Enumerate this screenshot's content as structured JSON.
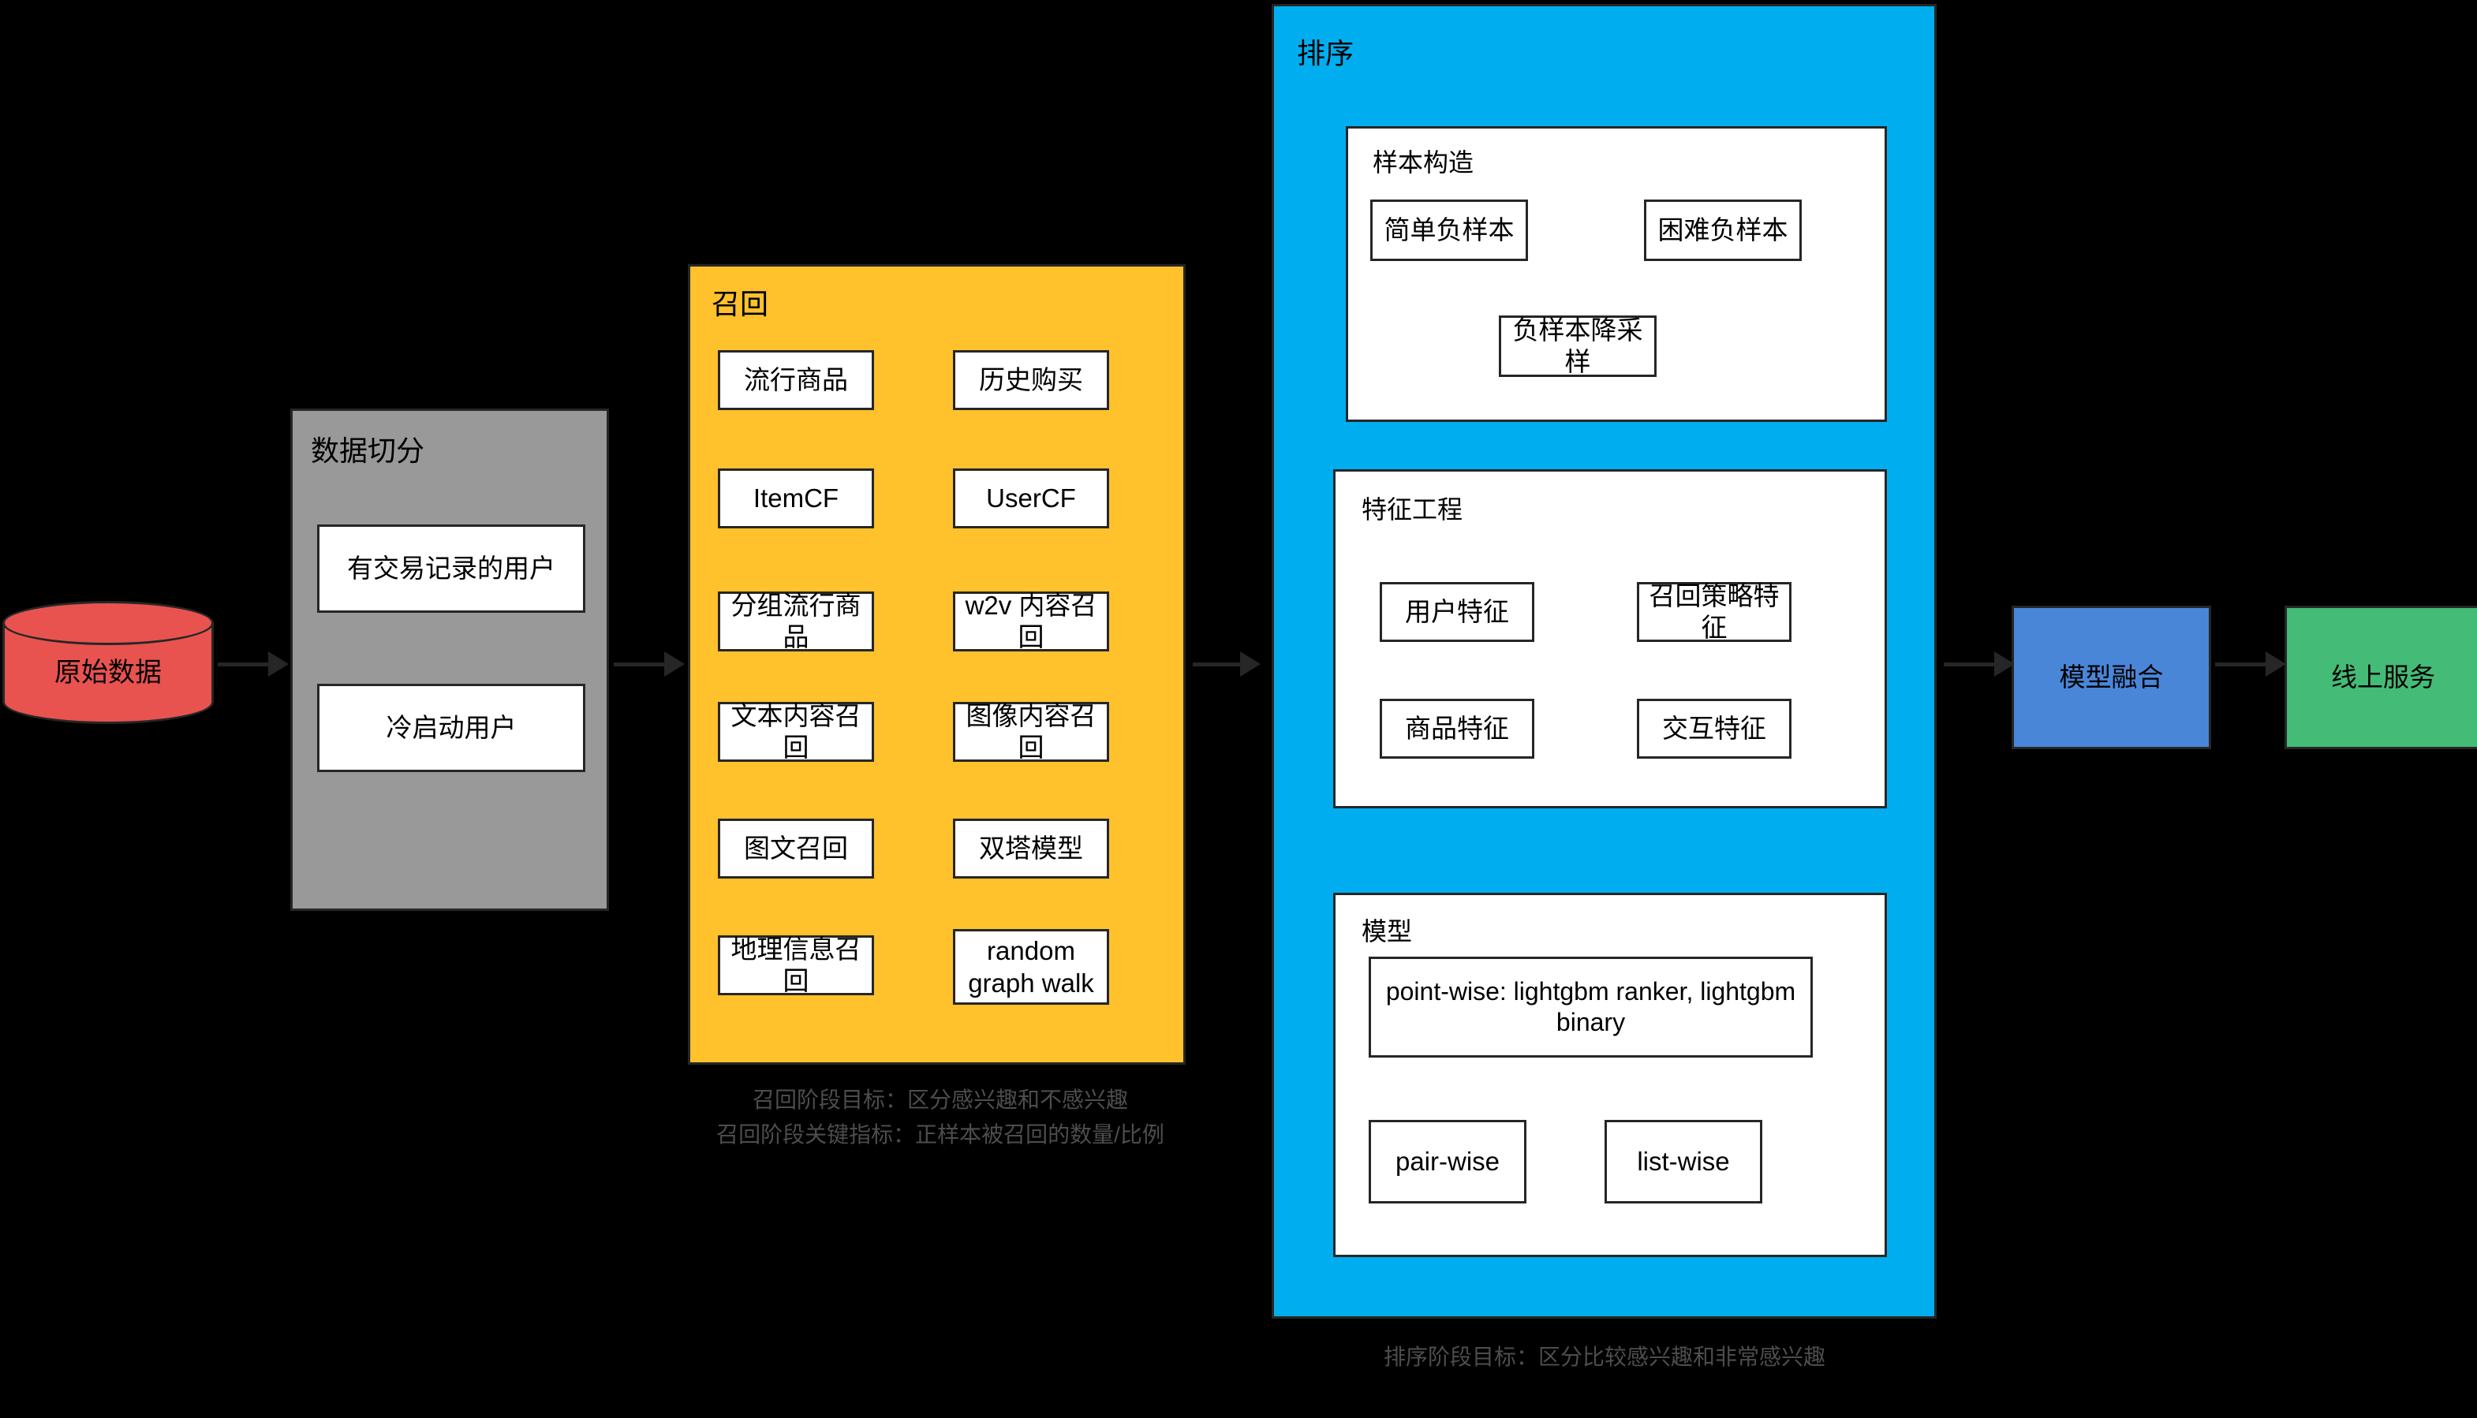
{
  "diagram": {
    "title": "recommendation-system-pipeline",
    "colors": {
      "background": "#000000",
      "raw_data_fill": "#e8534f",
      "data_split_fill": "#999999",
      "recall_fill": "#ffc12c",
      "ranking_fill": "#00aeef",
      "model_fusion_fill": "#4a86d8",
      "online_service_fill": "#44bb77",
      "panel_fill": "#ffffff",
      "stroke": "#262626",
      "caption_text": "#4d4d4d"
    }
  },
  "raw_data": {
    "label": "原始数据"
  },
  "data_split": {
    "title": "数据切分",
    "items": [
      {
        "label": "有交易记录的用户"
      },
      {
        "label": "冷启动用户"
      }
    ]
  },
  "recall": {
    "title": "召回",
    "items": [
      {
        "label": "流行商品"
      },
      {
        "label": "历史购买"
      },
      {
        "label": "ItemCF"
      },
      {
        "label": "UserCF"
      },
      {
        "label": "分组流行商品"
      },
      {
        "label": "w2v 内容召回"
      },
      {
        "label": "文本内容召回"
      },
      {
        "label": "图像内容召回"
      },
      {
        "label": "图文召回"
      },
      {
        "label": "双塔模型"
      },
      {
        "label": "地理信息召回"
      },
      {
        "label": "random graph walk"
      }
    ],
    "captions": [
      "召回阶段目标：区分感兴趣和不感兴趣",
      "召回阶段关键指标：正样本被召回的数量/比例"
    ]
  },
  "ranking": {
    "title": "排序",
    "panels": [
      {
        "title": "样本构造",
        "items": [
          {
            "label": "简单负样本"
          },
          {
            "label": "困难负样本"
          },
          {
            "label": "负样本降采样"
          }
        ]
      },
      {
        "title": "特征工程",
        "items": [
          {
            "label": "用户特征"
          },
          {
            "label": "召回策略特征"
          },
          {
            "label": "商品特征"
          },
          {
            "label": "交互特征"
          }
        ]
      },
      {
        "title": "模型",
        "items": [
          {
            "label": "point-wise: lightgbm ranker, lightgbm binary"
          },
          {
            "label": "pair-wise"
          },
          {
            "label": "list-wise"
          }
        ]
      }
    ],
    "captions": [
      "排序阶段目标：区分比较感兴趣和非常感兴趣"
    ]
  },
  "model_fusion": {
    "label": "模型融合"
  },
  "online_service": {
    "label": "线上服务"
  },
  "arrows": [
    {
      "name": "raw-data-to-data-split"
    },
    {
      "name": "data-split-to-recall"
    },
    {
      "name": "recall-to-ranking"
    },
    {
      "name": "ranking-to-model-fusion"
    },
    {
      "name": "model-fusion-to-online-service"
    }
  ]
}
